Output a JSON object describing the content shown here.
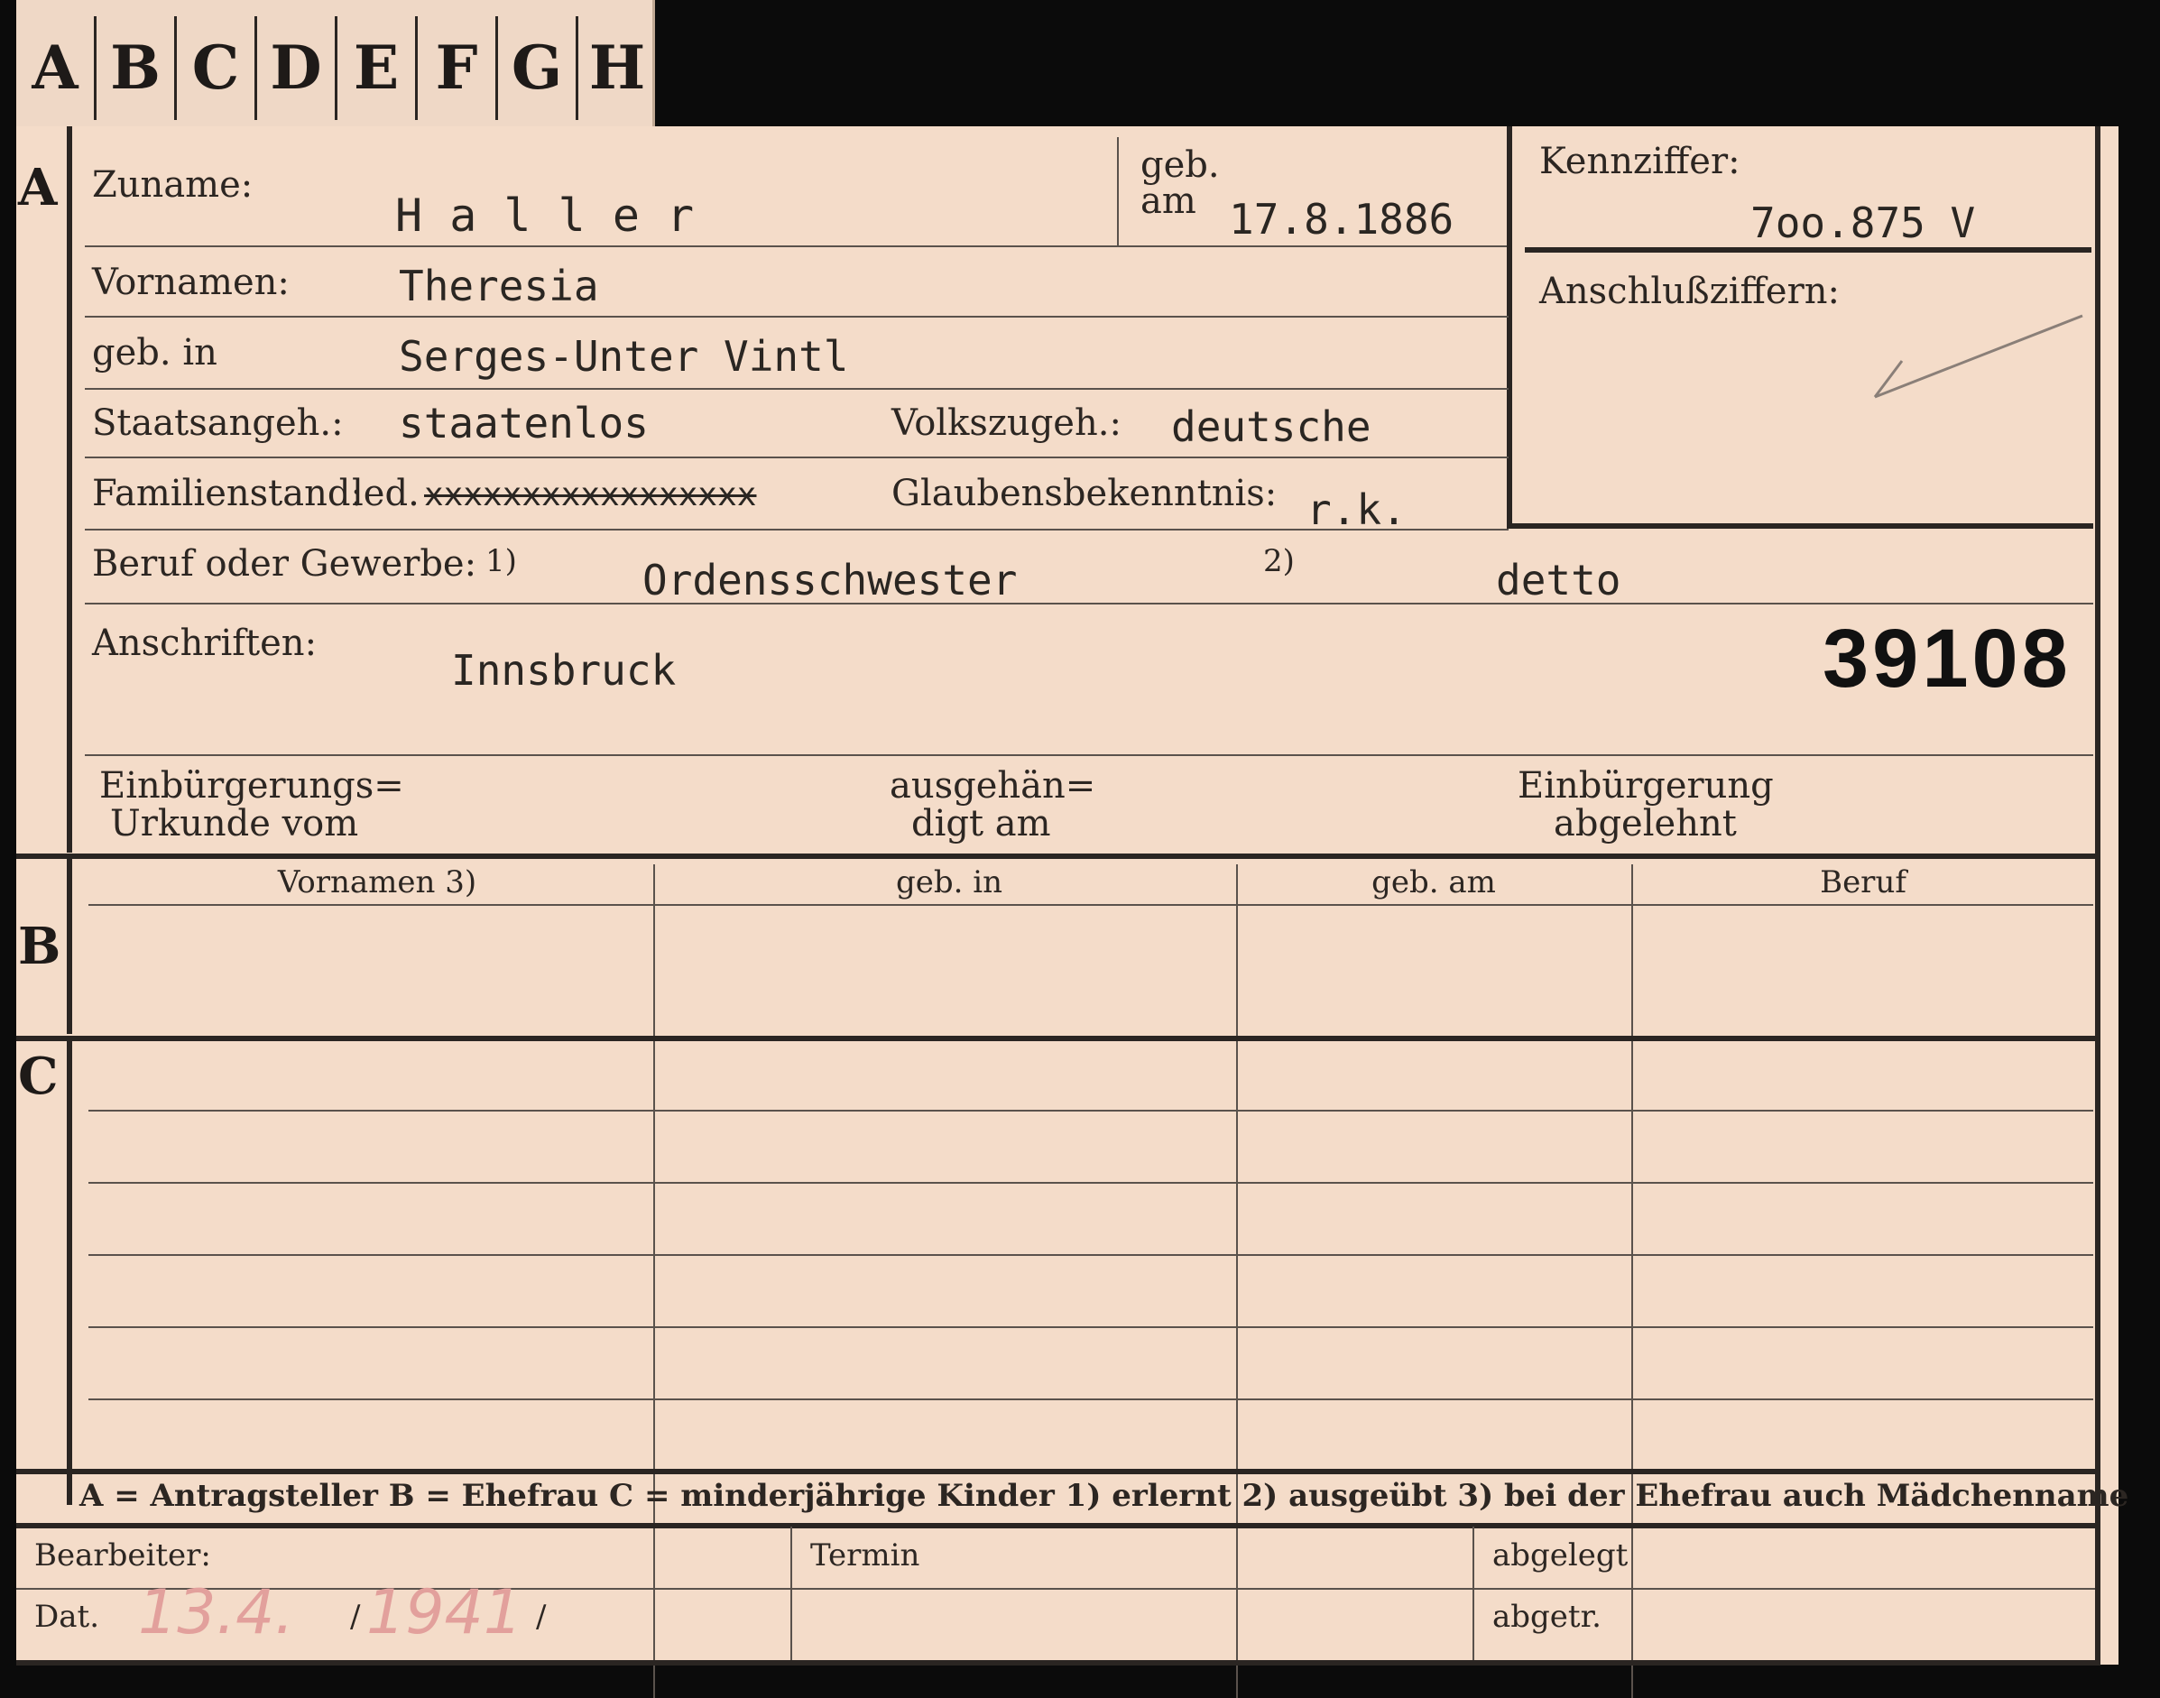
{
  "tabs": [
    "A",
    "B",
    "C",
    "D",
    "E",
    "F",
    "G",
    "H"
  ],
  "section_a": {
    "marker": "A",
    "zuname_label": "Zuname:",
    "zuname": "H a l l e r",
    "geb_label_top": "geb.",
    "geb_label_bottom": "am",
    "geb_am": "17.8.1886",
    "kennziffer_label": "Kennziffer:",
    "kennziffer": "7oo.875  V",
    "anschluss_label": "Anschlußziffern:",
    "vornamen_label": "Vornamen:",
    "vornamen": "Theresia",
    "geb_in_label": "geb. in",
    "geb_in": "Serges-Unter Vintl",
    "staat_label": "Staatsangeh.:",
    "staat": "staatenlos",
    "volk_label": "Volkszugeh.:",
    "volk": "deutsche",
    "familienstand_label": "Familienstand:",
    "familienstand_led": "led.",
    "familienstand_struck": "xxxxxxxxxxxxxxxxx",
    "glaube_label": "Glaubensbekenntnis:",
    "glaube": "r.k.",
    "beruf_label": "Beruf oder Gewerbe:",
    "beruf_fn1": "1)",
    "beruf1": "Ordensschwester",
    "beruf_fn2": "2)",
    "beruf2": "detto",
    "anschriften_label": "Anschriften:",
    "anschrift": "Innsbruck",
    "stamp_number": "39108",
    "einb_urkunde_1": "Einbürgerungs=",
    "einb_urkunde_2": "Urkunde vom",
    "ausgehaendigt_1": "ausgehän=",
    "ausgehaendigt_2": "digt am",
    "einb_abgelehnt_1": "Einbürgerung",
    "einb_abgelehnt_2": "abgelehnt"
  },
  "section_b": {
    "marker": "B",
    "columns": [
      "Vornamen 3)",
      "geb. in",
      "geb. am",
      "Beruf"
    ]
  },
  "section_c": {
    "marker": "C"
  },
  "legend": "A = Antragsteller   B = Ehefrau   C = minderjährige Kinder   1) erlernt   2) ausgeübt   3) bei der Ehefrau auch Mädchenname",
  "footer": {
    "bearbeiter_label": "Bearbeiter:",
    "dat_label": "Dat.",
    "dat_day": "13.4.",
    "dat_sep1": "/",
    "dat_year": "1941",
    "dat_sep2": "/",
    "termin_label": "Termin",
    "abgelegt_label": "abgelegt",
    "abgetr_label": "abgetr."
  },
  "colors": {
    "card": "#f4dcc9",
    "ink": "#2a2522",
    "red_pencil": "#e2a09c",
    "background": "#0b0b0b"
  }
}
